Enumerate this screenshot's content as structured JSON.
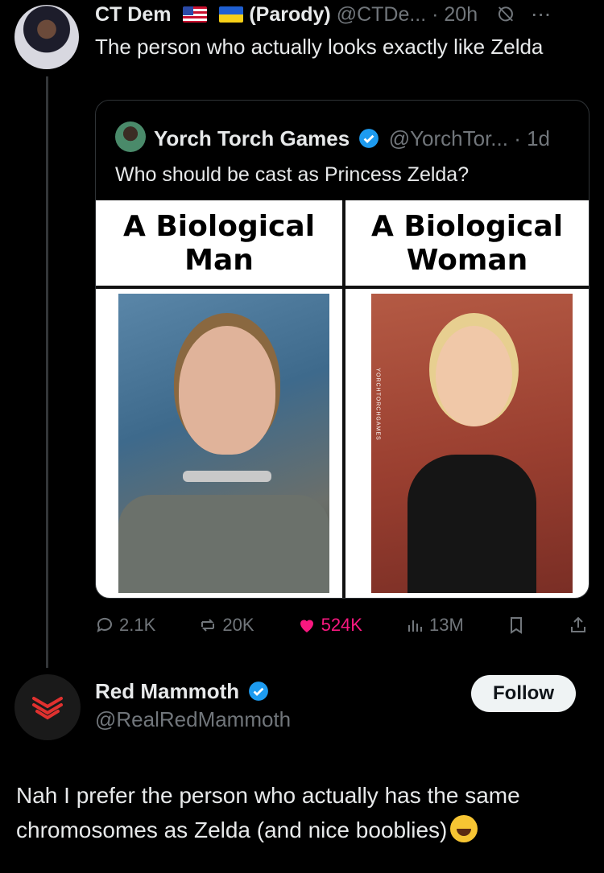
{
  "tweet": {
    "author": "CT Dem",
    "parody_tag": "(Parody)",
    "handle_time": "@CTDe... · 20h",
    "text": "The person who actually looks exactly like Zelda"
  },
  "quote": {
    "author": "Yorch Torch Games",
    "handle_time": "@YorchTor... · 1d",
    "text": "Who should be cast as Princess Zelda?",
    "meme": {
      "left_caption": "A Biological Man",
      "right_caption": "A Biological Woman",
      "watermark": "YORCHTORCHGAMES"
    }
  },
  "actions": {
    "replies": "2.1K",
    "reposts": "20K",
    "likes": "524K",
    "views": "13M"
  },
  "reply": {
    "author": "Red Mammoth",
    "handle": "@RealRedMammoth",
    "follow_label": "Follow",
    "text": "Nah I prefer the person who actually has the same chromosomes as Zelda (and nice booblies)"
  },
  "colors": {
    "background": "#000000",
    "muted": "#71767b",
    "verified": "#1d9bf0",
    "like": "#f91880"
  }
}
